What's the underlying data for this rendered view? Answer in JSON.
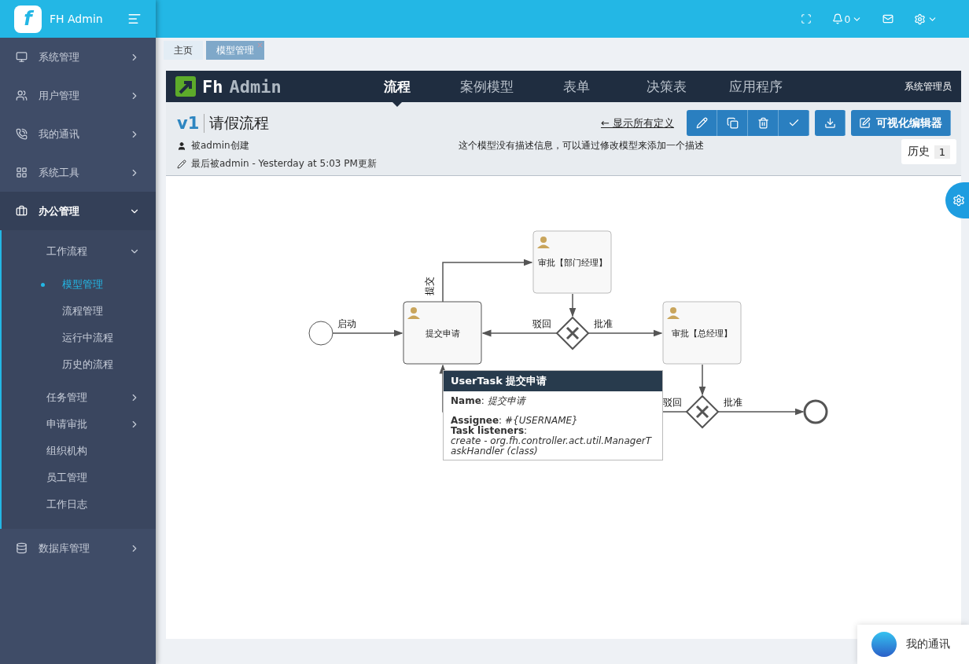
{
  "brand": {
    "name": "FH Admin",
    "logo_letter": "f"
  },
  "sidebar": {
    "items": [
      {
        "label": "系统管理",
        "expanded": false
      },
      {
        "label": "用户管理",
        "expanded": false
      },
      {
        "label": "我的通讯",
        "expanded": false
      },
      {
        "label": "系统工具",
        "expanded": false
      },
      {
        "label": "办公管理",
        "expanded": true,
        "children": [
          {
            "kind": "group",
            "label": "工作流程",
            "expanded": true,
            "children": [
              {
                "label": "模型管理",
                "selected": true
              },
              {
                "label": "流程管理",
                "selected": false
              },
              {
                "label": "运行中流程",
                "selected": false
              },
              {
                "label": "历史的流程",
                "selected": false
              }
            ]
          },
          {
            "kind": "group",
            "label": "任务管理",
            "expanded": false
          },
          {
            "kind": "group",
            "label": "申请审批",
            "expanded": false
          },
          {
            "kind": "link",
            "label": "组织机构"
          },
          {
            "kind": "link",
            "label": "员工管理"
          },
          {
            "kind": "link",
            "label": "工作日志"
          }
        ]
      },
      {
        "label": "数据库管理",
        "expanded": false
      }
    ]
  },
  "topbar": {
    "notification_count": "0"
  },
  "page_tabs": [
    {
      "label": "主页",
      "selected": false
    },
    {
      "label": "模型管理",
      "selected": true
    }
  ],
  "app_nav": {
    "logo_first": "Fh",
    "logo_second": "Admin",
    "items": [
      {
        "label": "流程",
        "selected": true
      },
      {
        "label": "案例模型",
        "selected": false
      },
      {
        "label": "表单",
        "selected": false
      },
      {
        "label": "决策表",
        "selected": false
      },
      {
        "label": "应用程序",
        "selected": false
      }
    ],
    "user": "系统管理员"
  },
  "model": {
    "version": "v1",
    "title": "请假流程",
    "back_link": "← 显示所有定义",
    "editor_button": "可视化编辑器",
    "created": "被admin创建",
    "updated": "最后被admin - Yesterday at 5:03 PM更新",
    "description": "这个模型没有描述信息，可以通过修改模型来添加一个描述",
    "history_label": "历史",
    "history_count": "1"
  },
  "diagram": {
    "nodes": [
      {
        "kind": "start"
      },
      {
        "kind": "task",
        "label": "提交申请"
      },
      {
        "kind": "task",
        "label": "审批【部门经理】"
      },
      {
        "kind": "gateway"
      },
      {
        "kind": "task",
        "label": "审批【总经理】"
      },
      {
        "kind": "gateway"
      },
      {
        "kind": "end"
      }
    ],
    "edge_labels": [
      "启动",
      "提交",
      "驳回",
      "批准",
      "驳回",
      "批准"
    ],
    "tooltip": {
      "title": "UserTask 提交申请",
      "fields": [
        "**Name**: *提交申请*",
        "**Assignee**: *#{USERNAME}*",
        "**Task listeners**:",
        "*create - org.fh.controller.act.util.ManagerTaskHandler (class)*"
      ]
    }
  },
  "chat_widget": {
    "label": "我的通讯"
  }
}
